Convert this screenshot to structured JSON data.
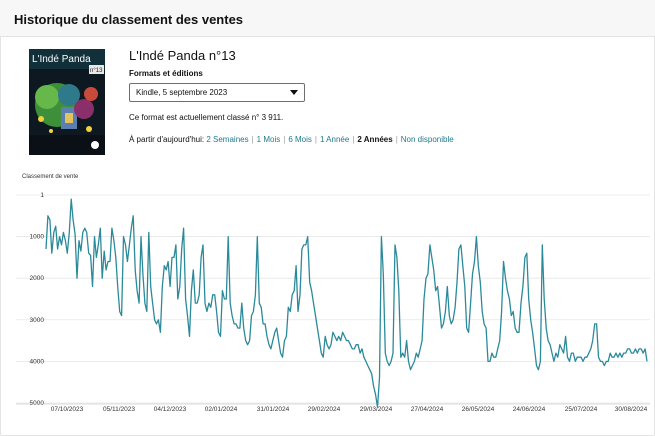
{
  "header": {
    "title": "Historique du classement des ventes"
  },
  "product": {
    "title": "L'Indé Panda n°13",
    "formats_label": "Formats et éditions",
    "selected_format": "Kindle, 5 septembre 2023",
    "current_rank_text": "Ce format est actuellement classé n° 3 911.",
    "cover": {
      "title_text": "L'Indé Panda",
      "badge": "n°13"
    }
  },
  "range": {
    "prefix": "À partir d'aujourd'hui:",
    "options": [
      {
        "label": "2 Semaines",
        "active": false
      },
      {
        "label": "1 Mois",
        "active": false
      },
      {
        "label": "6 Mois",
        "active": false
      },
      {
        "label": "1 Année",
        "active": false
      },
      {
        "label": "2 Années",
        "active": true
      },
      {
        "label": "Non disponible",
        "active": false
      }
    ]
  },
  "colors": {
    "line": "#2b8a9a",
    "link": "#1f7a8c",
    "grid": "#e6e6e6"
  },
  "chart_data": {
    "type": "line",
    "ylabel": "Classement de vente",
    "y_inverted": true,
    "ylim": [
      5000,
      1
    ],
    "y_ticks": [
      1,
      1000,
      2000,
      3000,
      4000,
      5000
    ],
    "y_tick_labels": [
      "1",
      "1000",
      "2000",
      "3000",
      "4000",
      "5000"
    ],
    "x_tick_labels": [
      "07/10/2023",
      "05/11/2023",
      "04/12/2023",
      "02/01/2024",
      "31/01/2024",
      "29/02/2024",
      "29/03/2024",
      "27/04/2024",
      "26/05/2024",
      "24/06/2024",
      "25/07/2024",
      "30/08/2024"
    ],
    "series": [
      {
        "values": [
          1300,
          500,
          600,
          1400,
          900,
          750,
          1300,
          1000,
          1200,
          900,
          1100,
          1400,
          900,
          100,
          600,
          950,
          2000,
          1100,
          1350,
          900,
          800,
          900,
          1400,
          1450,
          2200,
          1000,
          1500,
          1200,
          800,
          2000,
          1350,
          1800,
          1600,
          1600,
          800,
          1100,
          1500,
          2200,
          2800,
          2900,
          1000,
          1200,
          1600,
          1200,
          800,
          500,
          1800,
          2300,
          2600,
          1000,
          1900,
          2600,
          2800,
          900,
          2200,
          2600,
          3000,
          3100,
          3000,
          3300,
          2200,
          1700,
          1800,
          1600,
          2200,
          1500,
          1500,
          1200,
          2500,
          2200,
          1300,
          800,
          2500,
          2900,
          3400,
          2300,
          1800,
          2600,
          2600,
          2400,
          1500,
          1200,
          2600,
          2800,
          2600,
          2700,
          2400,
          2400,
          2800,
          3300,
          3400,
          2300,
          2500,
          2500,
          1000,
          2600,
          2900,
          3100,
          3100,
          3200,
          3200,
          2600,
          3200,
          3500,
          3600,
          3500,
          2900,
          2800,
          2400,
          1000,
          2600,
          2700,
          3100,
          3100,
          3400,
          3600,
          3700,
          3500,
          3300,
          3200,
          3500,
          3800,
          3900,
          3500,
          3400,
          2700,
          2800,
          2400,
          2300,
          1700,
          2800,
          2400,
          1300,
          1200,
          1200,
          1000,
          2100,
          2300,
          2600,
          2900,
          3200,
          3500,
          3800,
          3900,
          3400,
          3600,
          3700,
          3600,
          3300,
          3400,
          3500,
          3400,
          3500,
          3300,
          3400,
          3500,
          3500,
          3600,
          3700,
          3700,
          3600,
          3600,
          3800,
          3700,
          3900,
          4000,
          4100,
          4200,
          4300,
          4600,
          4800,
          5100,
          4400,
          1000,
          1900,
          3800,
          4000,
          4100,
          4000,
          3800,
          1200,
          1500,
          2300,
          3900,
          3800,
          3900,
          3500,
          4000,
          4200,
          4100,
          4000,
          3800,
          3900,
          3700,
          3500,
          2500,
          2000,
          1900,
          1200,
          1500,
          1800,
          2300,
          2200,
          2700,
          3200,
          3100,
          2800,
          2200,
          2900,
          3100,
          3000,
          2700,
          2100,
          1300,
          1200,
          1700,
          2200,
          3200,
          3300,
          2600,
          1900,
          1600,
          1000,
          1700,
          2100,
          2800,
          3100,
          3200,
          4000,
          4000,
          3800,
          3900,
          3900,
          3700,
          3500,
          2800,
          1600,
          2000,
          2300,
          2500,
          2900,
          2800,
          3200,
          3300,
          3300,
          2600,
          2200,
          1500,
          1400,
          2500,
          3000,
          3300,
          3700,
          4100,
          4200,
          4000,
          1200,
          2500,
          3200,
          3500,
          3600,
          3800,
          4000,
          3800,
          3900,
          3600,
          3700,
          3800,
          3400,
          3900,
          4000,
          3800,
          3800,
          4000,
          3900,
          3900,
          3900,
          4000,
          3900,
          3900,
          3800,
          3700,
          3500,
          3100,
          3100,
          3900,
          4000,
          4000,
          4100,
          4000,
          4000,
          3800,
          3900,
          3900,
          3800,
          3900,
          3800,
          3900,
          3800,
          3800,
          3700,
          3700,
          3800,
          3800,
          3700,
          3800,
          3700,
          3700,
          3800,
          3700,
          4000
        ]
      }
    ]
  }
}
